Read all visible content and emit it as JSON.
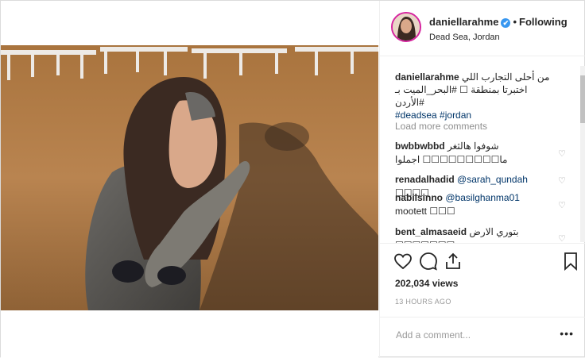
{
  "post": {
    "username": "daniellarahme",
    "verified_glyph": "✔",
    "separator": "•",
    "follow_label": "Following",
    "location": "Dead Sea, Jordan",
    "caption_user": "daniellarahme",
    "caption_text": "من أحلى التجارب اللي اختبرتا بمنطقة ☐ #البحر_الميت بـ #الأردن",
    "caption_tags": "#deadsea #jordan",
    "load_more": "Load more comments",
    "comments": [
      {
        "user": "bwbbwbbd",
        "text": "شوفوا هالثغر ما☐☐☐☐☐☐☐☐☐ اجملوا"
      },
      {
        "user": "renadalhadid",
        "mention": "@sarah_qundah",
        "text": "☐☐☐☐"
      },
      {
        "user": "nabilsinno",
        "mention": "@basilghanma01",
        "text": "mootett ☐☐☐"
      },
      {
        "user": "bent_almasaeid",
        "text": "بتوري الارض ☐☐☐☐☐☐☐"
      }
    ],
    "views": "202,034 views",
    "time": "13 HOURS AGO",
    "add_comment_placeholder": "Add a comment...",
    "more_label": "•••"
  },
  "icons": {
    "like": "heart-icon",
    "comment": "comment-icon",
    "share": "share-icon",
    "save": "bookmark-icon"
  },
  "colors": {
    "verified": "#3897f0",
    "link": "#003569",
    "muted": "#8e8e8e"
  }
}
